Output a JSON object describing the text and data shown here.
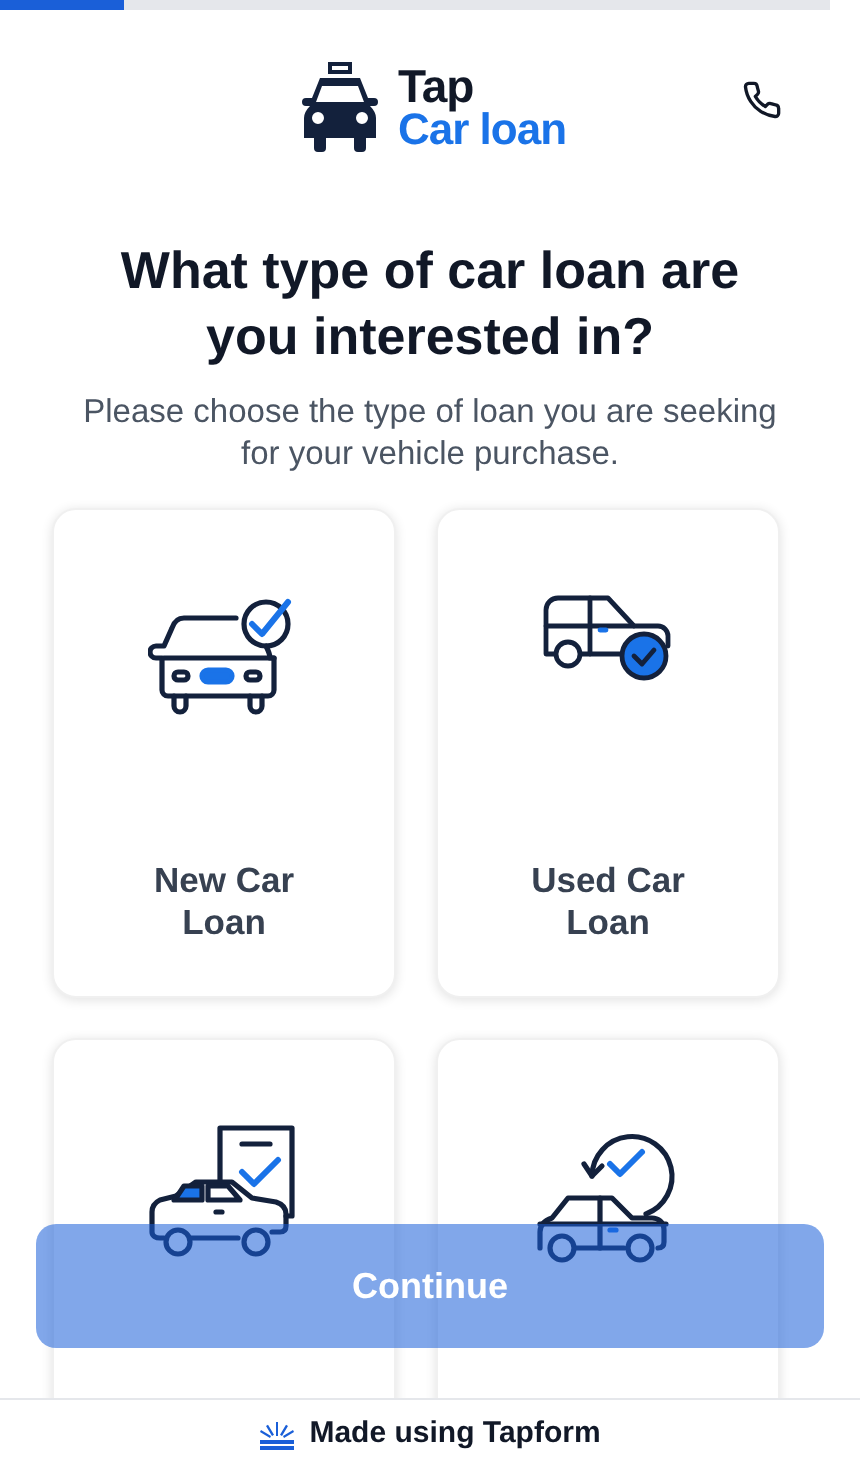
{
  "progress": {
    "level": 0.15
  },
  "header": {
    "brand_top": "Tap",
    "brand_bottom": "Car loan"
  },
  "question": {
    "title": "What type of car loan are you interested in?",
    "subtitle": "Please choose the type of loan you are seeking for your vehicle purchase."
  },
  "options": [
    {
      "kind": "new",
      "label": "New Car Loan",
      "selected": false
    },
    {
      "kind": "used",
      "label": "Used Car Loan",
      "selected": false
    },
    {
      "kind": "approved",
      "selected": false
    },
    {
      "kind": "refinance",
      "selected": false
    }
  ],
  "continue_button": {
    "label": "Continue",
    "disabled": true
  },
  "footer": {
    "text": "Made using Tapform"
  }
}
